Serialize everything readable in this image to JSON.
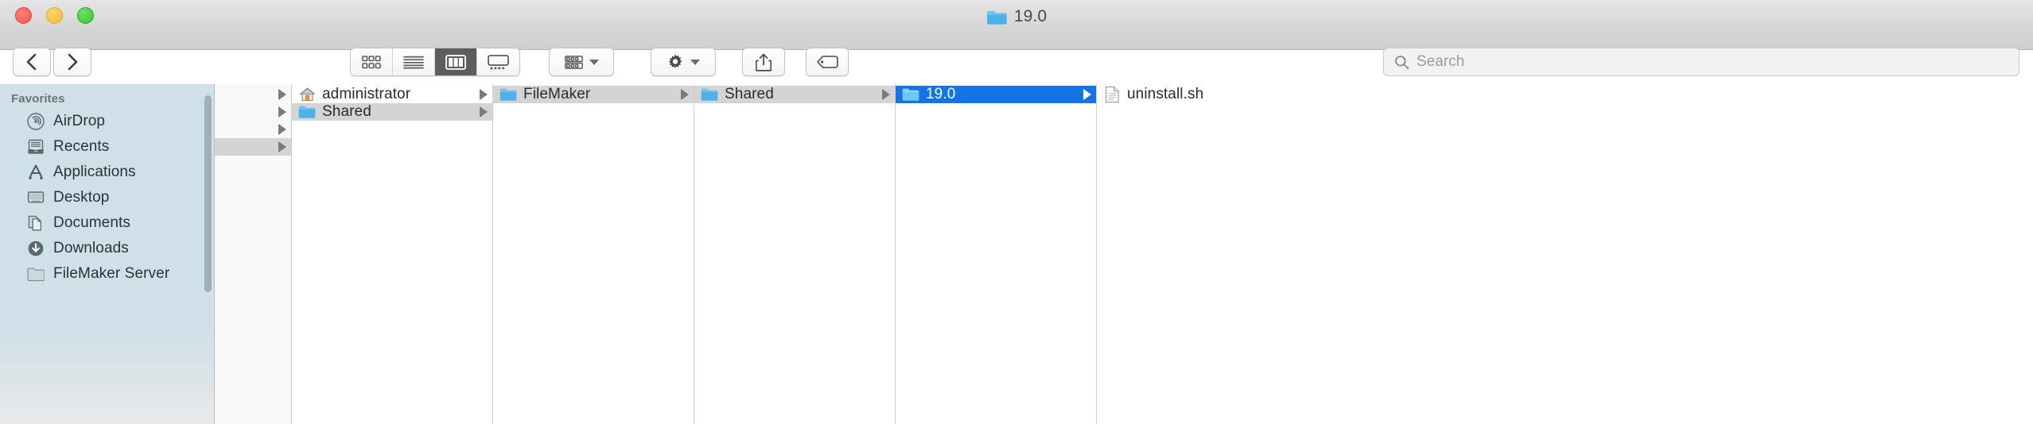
{
  "window": {
    "title": "19.0",
    "title_icon": "folder-icon",
    "traffic_lights": [
      {
        "name": "close",
        "color": "#f0554c"
      },
      {
        "name": "minimize",
        "color": "#f4bd37"
      },
      {
        "name": "maximize",
        "color": "#34c42c"
      }
    ]
  },
  "toolbar": {
    "back_label": "‹",
    "forward_label": "›",
    "view_modes": [
      {
        "name": "icon-view",
        "active": false
      },
      {
        "name": "list-view",
        "active": false
      },
      {
        "name": "column-view",
        "active": true
      },
      {
        "name": "gallery-view",
        "active": false
      }
    ],
    "group_button": "group-by-icon",
    "action_button": "gear-icon",
    "share_button": "share-icon",
    "tag_button": "tag-icon"
  },
  "search": {
    "placeholder": "Search",
    "value": "",
    "icon": "search-icon"
  },
  "sidebar": {
    "header": "Favorites",
    "items": [
      {
        "label": "AirDrop",
        "icon": "airdrop-icon"
      },
      {
        "label": "Recents",
        "icon": "recents-icon"
      },
      {
        "label": "Applications",
        "icon": "applications-icon"
      },
      {
        "label": "Desktop",
        "icon": "desktop-icon"
      },
      {
        "label": "Documents",
        "icon": "documents-icon"
      },
      {
        "label": "Downloads",
        "icon": "downloads-icon"
      },
      {
        "label": "FileMaker Server",
        "icon": "folder-icon"
      }
    ]
  },
  "columns": [
    {
      "name": "column-0",
      "rows": [
        {
          "label": "",
          "icon": "",
          "disclosure": true,
          "selection": "none"
        },
        {
          "label": "",
          "icon": "",
          "disclosure": true,
          "selection": "none"
        },
        {
          "label": "",
          "icon": "",
          "disclosure": true,
          "selection": "none"
        },
        {
          "label": "",
          "icon": "",
          "disclosure": true,
          "selection": "gray"
        }
      ]
    },
    {
      "name": "column-1",
      "rows": [
        {
          "label": "administrator",
          "icon": "home-icon",
          "disclosure": true,
          "selection": "none"
        },
        {
          "label": "Shared",
          "icon": "folder-icon",
          "disclosure": true,
          "selection": "gray"
        }
      ]
    },
    {
      "name": "column-2",
      "rows": [
        {
          "label": "FileMaker",
          "icon": "folder-icon",
          "disclosure": true,
          "selection": "gray"
        }
      ]
    },
    {
      "name": "column-3",
      "rows": [
        {
          "label": "Shared",
          "icon": "folder-icon",
          "disclosure": true,
          "selection": "gray"
        }
      ]
    },
    {
      "name": "column-4",
      "rows": [
        {
          "label": "19.0",
          "icon": "folder-icon",
          "disclosure": true,
          "selection": "blue"
        }
      ]
    },
    {
      "name": "column-5",
      "rows": [
        {
          "label": "uninstall.sh",
          "icon": "document-icon",
          "disclosure": false,
          "selection": "none"
        }
      ]
    }
  ],
  "colors": {
    "selection_blue": "#1474e6",
    "selection_gray": "#d4d4d4",
    "folder_blue": "#4cb3e8",
    "sidebar_bg": "#cfe0e8",
    "toolbar_bg": "#d6d6d6"
  }
}
